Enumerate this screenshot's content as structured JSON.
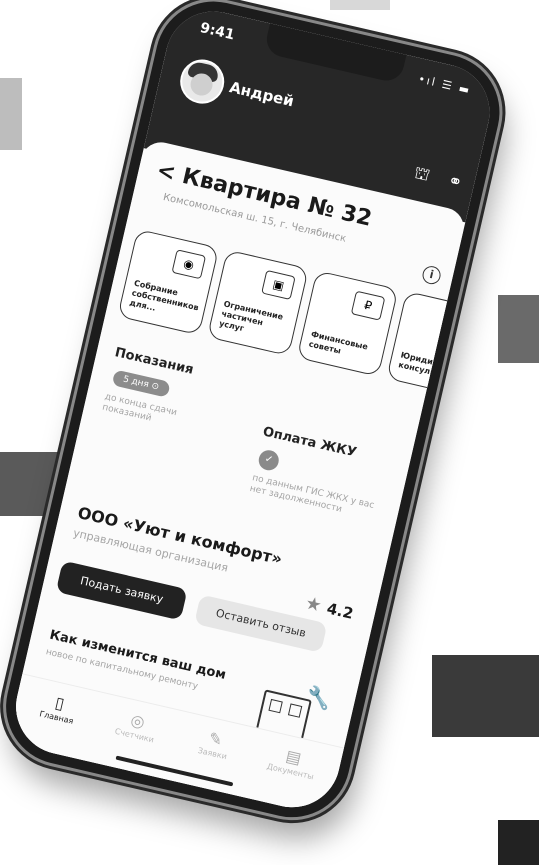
{
  "status_bar": {
    "time": "9:41",
    "icons": "•ıl ☰ ▬"
  },
  "header": {
    "user_name": "Андрей",
    "avatar_icon": "user-avatar",
    "bell_icon": "bell-icon",
    "support_icon": "headset-icon"
  },
  "apartment": {
    "title": "< Квартира № 32",
    "address": "Комсомольская ш. 15, г. Челябинск"
  },
  "tiles": [
    {
      "icon": "camera-icon",
      "label": "Собрание собственников для..."
    },
    {
      "icon": "tv-icon",
      "label": "Ограничение частичен услуг"
    },
    {
      "icon": "money-icon",
      "label": "Финансовые советы"
    },
    {
      "icon": "law-icon",
      "label": "Юридич. консульт."
    }
  ],
  "readings": {
    "title": "Показания",
    "chip": "5 дня ⊙",
    "subtitle": "до конца сдачи показаний"
  },
  "payment": {
    "title": "Оплата ЖКУ",
    "subtitle": "по данным ГИС ЖКХ у вас нет задолженности"
  },
  "company": {
    "name": "ООО «Уют и комфорт»",
    "role": "управляющая организация",
    "rating": "4.2",
    "primary_button": "Подать заявку",
    "secondary_button": "Оставить отзыв"
  },
  "news": {
    "title": "Как изменится ваш дом",
    "subtitle": "новое по капитальному ремонту"
  },
  "nav": [
    {
      "icon": "door-icon",
      "label": "Главная"
    },
    {
      "icon": "gauge-icon",
      "label": "Счетчики"
    },
    {
      "icon": "pencil-icon",
      "label": "Заявки"
    },
    {
      "icon": "document-icon",
      "label": "Документы"
    }
  ],
  "colors": {
    "header_bg": "#272727",
    "accent": "#222222",
    "chip": "#8c8c8c"
  }
}
